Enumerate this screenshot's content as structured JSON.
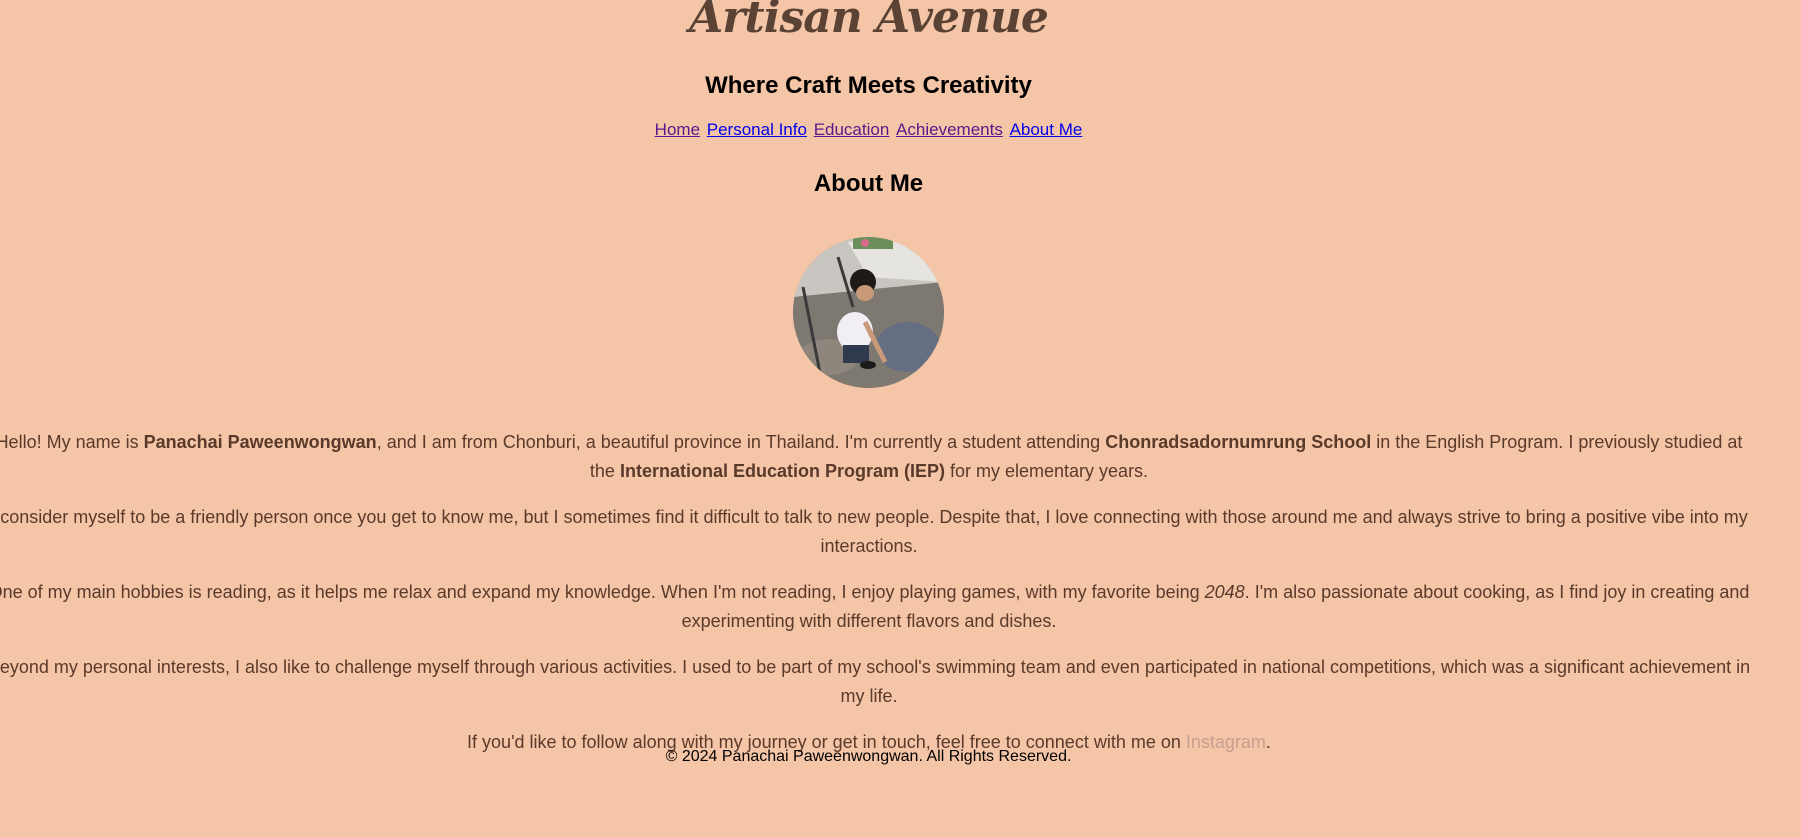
{
  "header": {
    "site_title": "Artisan Avenue",
    "tagline": "Where Craft Meets Creativity"
  },
  "nav": {
    "items": [
      {
        "label": "Home",
        "state": "visited"
      },
      {
        "label": "Personal Info",
        "state": "unvisited"
      },
      {
        "label": "Education",
        "state": "visited"
      },
      {
        "label": "Achievements",
        "state": "visited"
      },
      {
        "label": "About Me",
        "state": "unvisited"
      }
    ]
  },
  "main": {
    "title": "About Me",
    "avatar_icon": "profile-photo",
    "p1": {
      "a": "Hello! My name is ",
      "name": "Panachai Paweenwongwan",
      "b": ", and I am from Chonburi, a beautiful province in Thailand. I'm currently a student attending ",
      "school": "Chonradsadornumrung School",
      "c": " in the English Program. I previously studied at the ",
      "program": "International Education Program (IEP)",
      "d": " for my elementary years."
    },
    "p2": "I consider myself to be a friendly person once you get to know me, but I sometimes find it difficult to talk to new people. Despite that, I love connecting with those around me and always strive to bring a positive vibe into my interactions.",
    "p3": {
      "a": "One of my main hobbies is reading, as it helps me relax and expand my knowledge. When I'm not reading, I enjoy playing games, with my favorite being ",
      "game": "2048",
      "b": ". I'm also passionate about cooking, as I find joy in creating and experimenting with different flavors and dishes."
    },
    "p4": "Beyond my personal interests, I also like to challenge myself through various activities. I used to be part of my school's swimming team and even participated in national competitions, which was a significant achievement in my life.",
    "p5": {
      "a": "If you'd like to follow along with my journey or get in touch, feel free to connect with me on ",
      "link": "Instagram",
      "b": "."
    }
  },
  "footer": {
    "text": "© 2024 Panachai Paweenwongwan. All Rights Reserved."
  },
  "colors": {
    "background": "#f5c5a7",
    "title_brown": "#5a4334",
    "body_text": "#5a3a2a",
    "link_visited": "#551a8b",
    "link_unvisited": "#0000ee",
    "instagram_link": "#c4a08e"
  }
}
